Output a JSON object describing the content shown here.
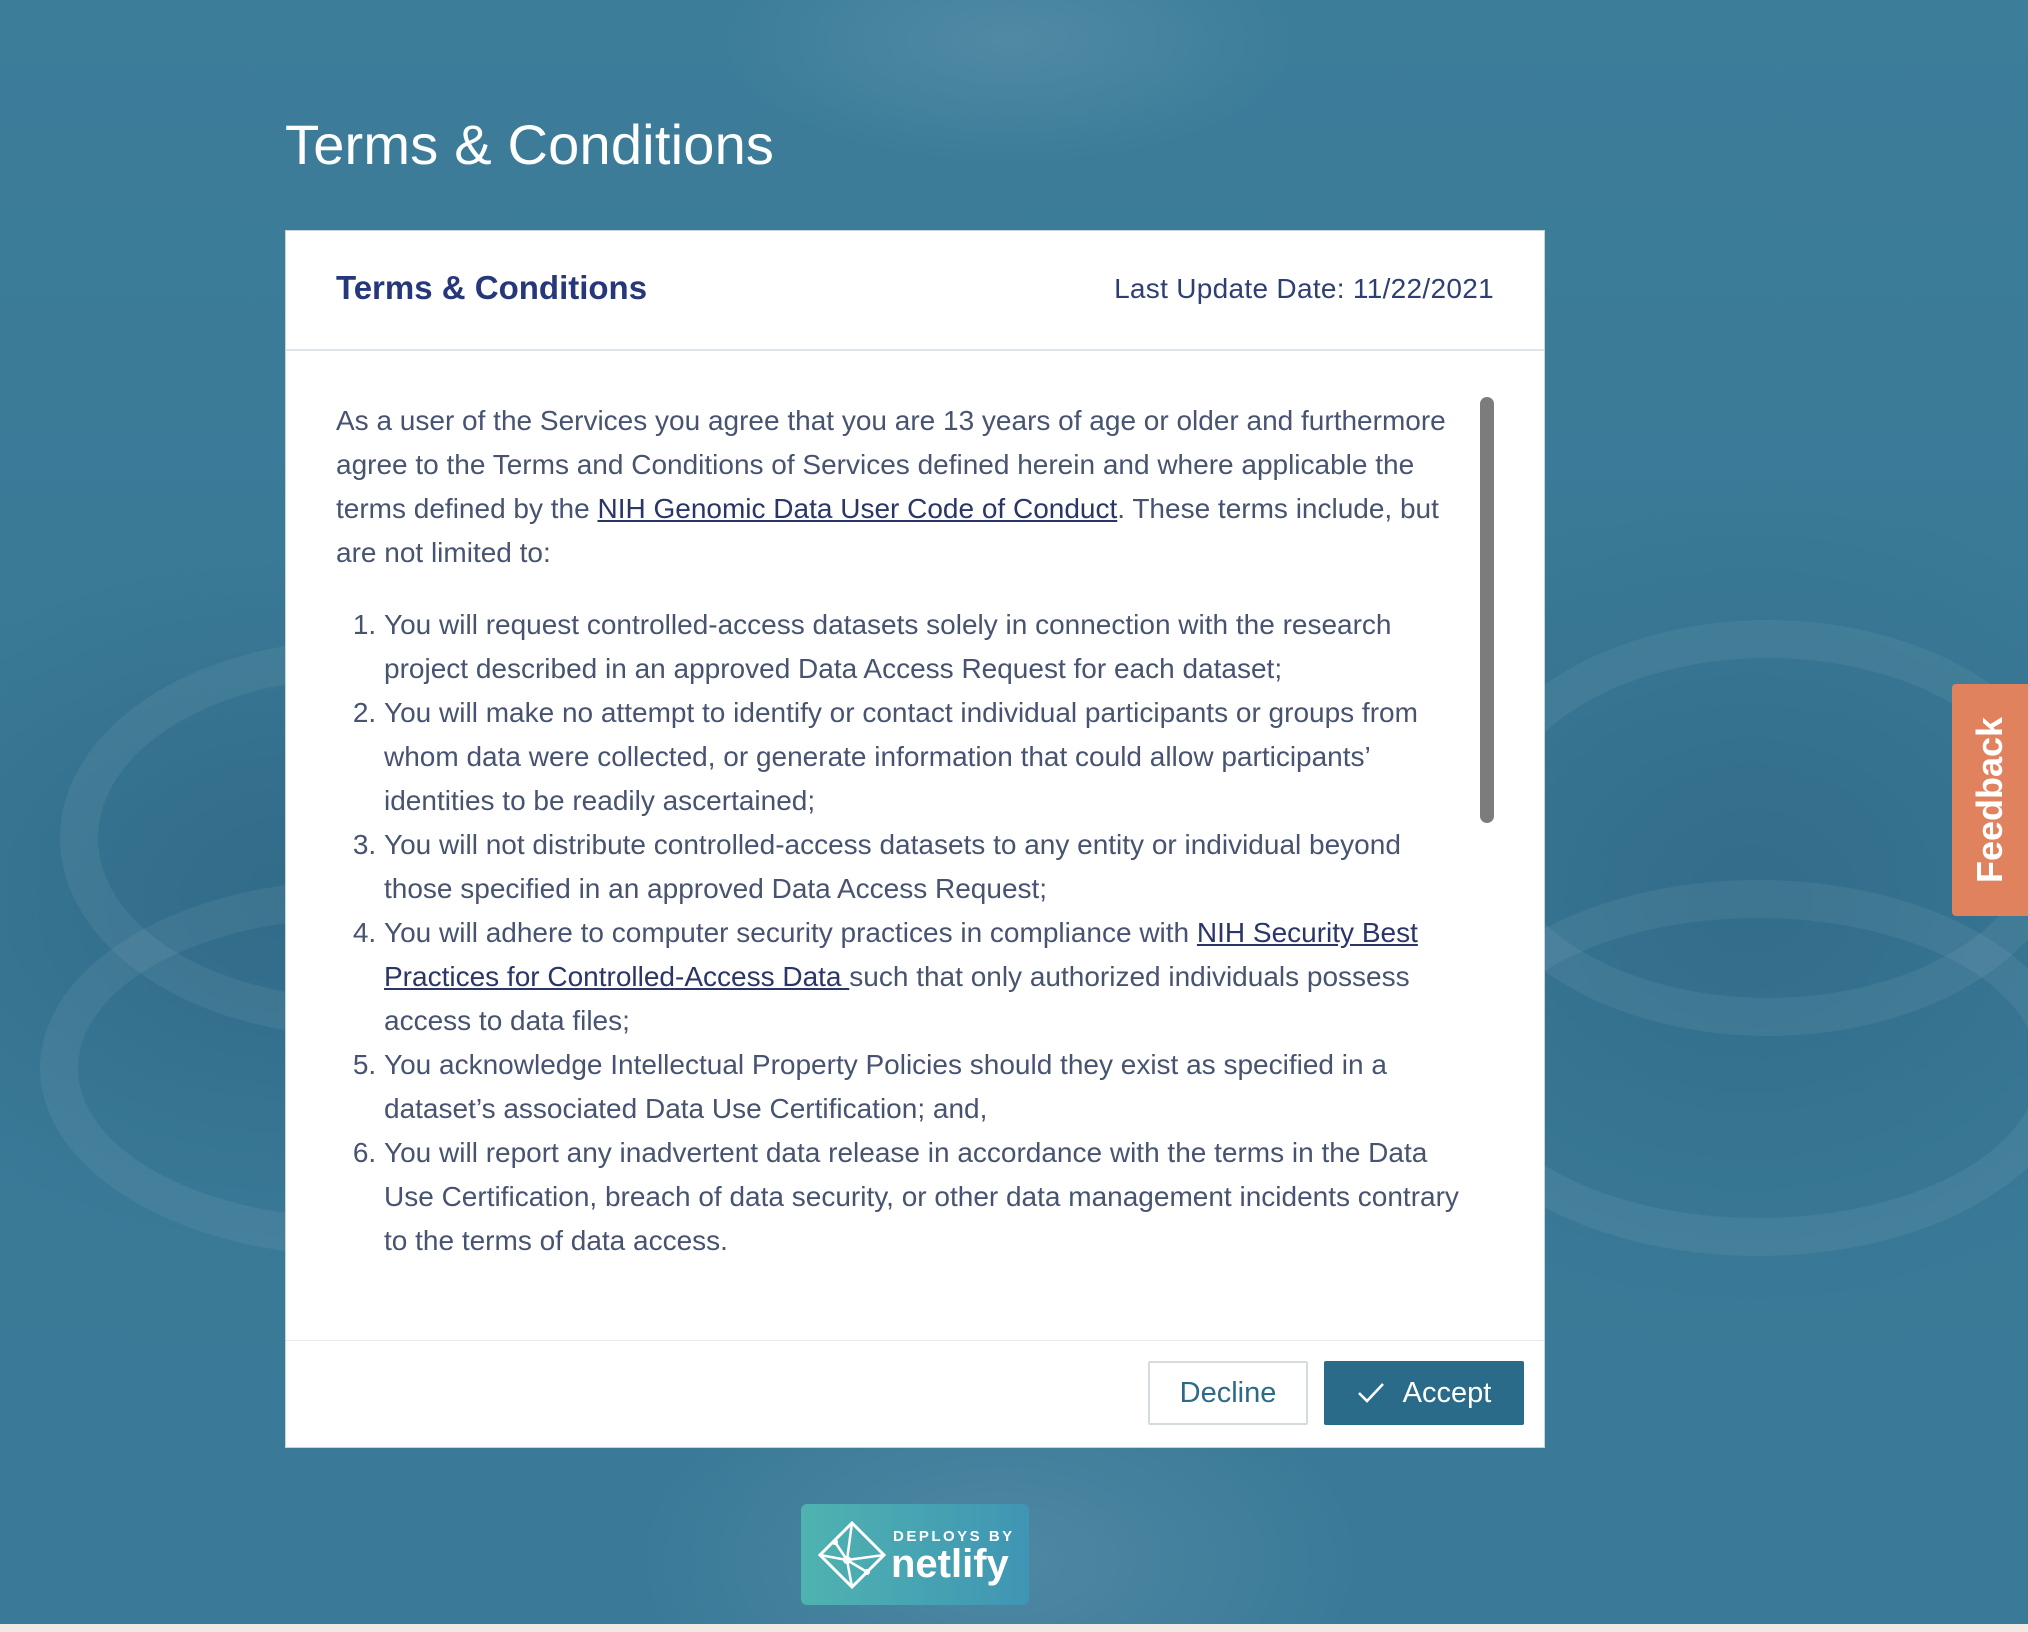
{
  "page": {
    "title": "Terms & Conditions"
  },
  "modal": {
    "title": "Terms & Conditions",
    "last_update": "Last Update Date: 11/22/2021",
    "intro_before_link": "As a user of the Services you agree that you are 13 years of age or older and furthermore agree to the Terms and Conditions of Services defined herein and where applicable the terms defined by the ",
    "intro_link": "NIH Genomic Data User Code of Conduct",
    "intro_after_link": ". These terms include, but are not limited to:",
    "terms": [
      "You will request controlled-access datasets solely in connection with the research project described in an approved Data Access Request for each dataset;",
      "You will make no attempt to identify or contact individual participants or groups from whom data were collected, or generate information that could allow participants’ identities to be readily ascertained;",
      "You will not distribute controlled-access datasets to any entity or individual beyond those specified in an approved Data Access Request;",
      {
        "before_link": "You will adhere to computer security practices in compliance with ",
        "link": "NIH Security Best Practices for Controlled-Access Data ",
        "after_link": "such that only authorized individuals possess access to data files;"
      },
      "You acknowledge Intellectual Property Policies should they exist as specified in a dataset’s associated Data Use Certification; and,",
      "You will report any inadvertent data release in accordance with the terms in the Data Use Certification, breach of data security, or other data management incidents contrary to the terms of data access."
    ],
    "decline_label": "Decline",
    "accept_label": "Accept",
    "accept_icon": "check-icon"
  },
  "netlify": {
    "small_text": "DEPLOYS BY",
    "big_text": "netlify"
  },
  "feedback": {
    "label": "Feedback"
  },
  "colors": {
    "background": "#3f7f9c",
    "title_text": "#26377a",
    "accept_button": "#2b6b8a",
    "feedback_tab": "#e0825e"
  }
}
